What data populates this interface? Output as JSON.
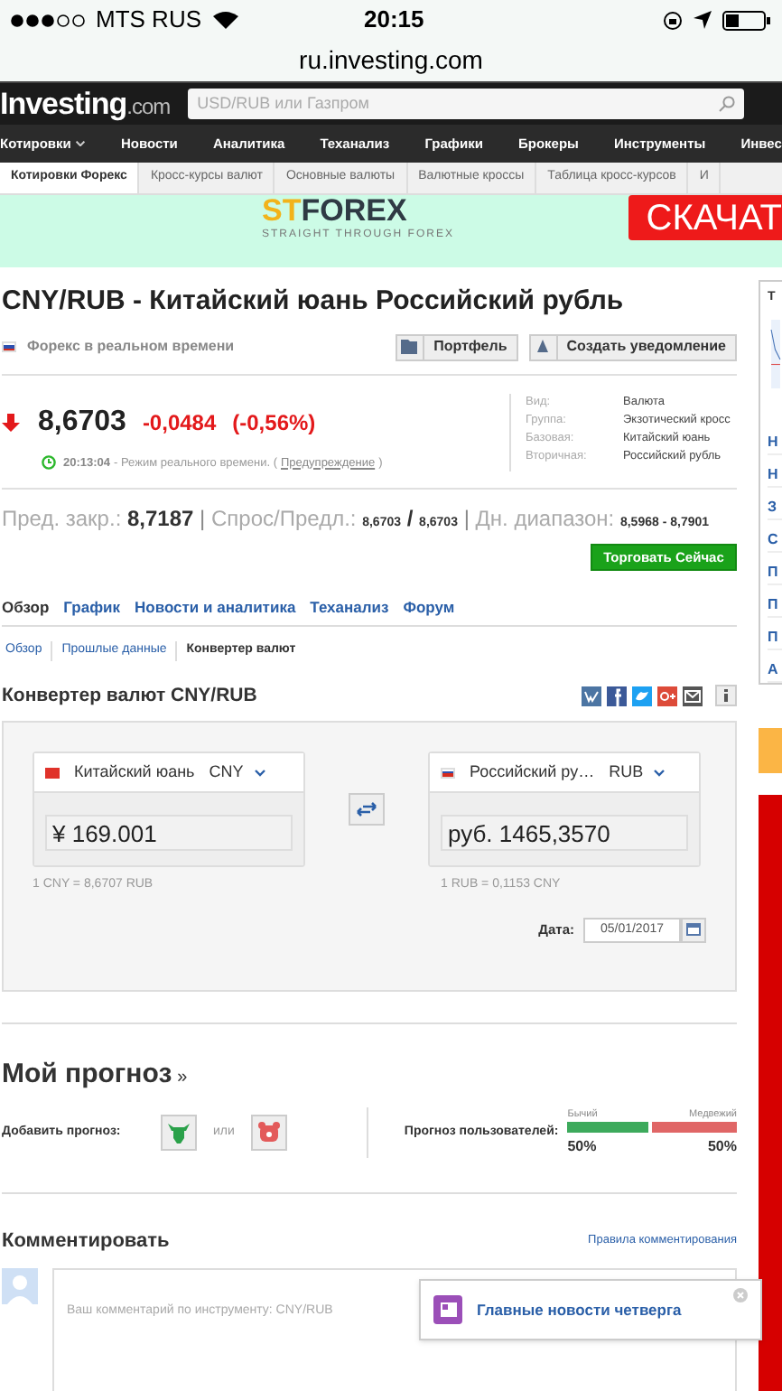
{
  "status_bar": {
    "carrier": "MTS RUS",
    "time": "20:15"
  },
  "url": "ru.investing.com",
  "header": {
    "logo": "Investing",
    "logo_suffix": ".com",
    "search_placeholder": "USD/RUB или Газпром"
  },
  "nav": [
    {
      "label": "Котировки",
      "has_menu": true
    },
    {
      "label": "Новости",
      "has_menu": false
    },
    {
      "label": "Аналитика",
      "has_menu": false
    },
    {
      "label": "Теханализ",
      "has_menu": false
    },
    {
      "label": "Графики",
      "has_menu": false
    },
    {
      "label": "Брокеры",
      "has_menu": false
    },
    {
      "label": "Инструменты",
      "has_menu": false
    },
    {
      "label": "Инвес",
      "has_menu": false
    }
  ],
  "subnav": [
    {
      "label": "Котировки Форекс",
      "selected": true
    },
    {
      "label": "Кросс-курсы валют",
      "selected": false
    },
    {
      "label": "Основные валюты",
      "selected": false
    },
    {
      "label": "Валютные кроссы",
      "selected": false
    },
    {
      "label": "Таблица кросс-курсов",
      "selected": false
    },
    {
      "label": "И",
      "selected": false
    }
  ],
  "ad": {
    "brand_prefix": "ST",
    "brand": "FOREX",
    "tagline": "STRAIGHT THROUGH FOREX",
    "cta": "СКАЧАТ"
  },
  "instrument": {
    "title": "CNY/RUB - Китайский юань Российский рубль",
    "market": "Форекс в реальном времени",
    "buttons": [
      "Портфель",
      "Создать уведомление"
    ],
    "price": "8,6703",
    "change": "-0,0484",
    "change_pct": "(-0,56%)",
    "falling": true,
    "time": "20:13:04",
    "time_note": "- Режим реального времени. (",
    "warning_link": "Предупреждение",
    "time_end": ")",
    "info": [
      {
        "label": "Вид:",
        "value": "Валюта"
      },
      {
        "label": "Группа:",
        "value": "Экзотический кросс"
      },
      {
        "label": "Базовая:",
        "value": "Китайский юань"
      },
      {
        "label": "Вторичная:",
        "value": "Российский рубль"
      }
    ],
    "prev_close_label": "Пред. закр.:",
    "prev_close": "8,7187",
    "separator": "|",
    "bid_ask_label": "Спрос/Предл.:",
    "bid": "8,6703",
    "bid_ask_sep": "/",
    "ask": "8,6703",
    "range_label": "Дн. диапазон:",
    "range": "8,5968 - 8,7901",
    "trade_button": "Торговать Сейчас"
  },
  "tabs": [
    {
      "label": "Обзор",
      "selected": true
    },
    {
      "label": "График",
      "selected": false
    },
    {
      "label": "Новости и аналитика",
      "selected": false
    },
    {
      "label": "Теханализ",
      "selected": false
    },
    {
      "label": "Форум",
      "selected": false
    }
  ],
  "subtabs": [
    {
      "label": "Обзор",
      "selected": false
    },
    {
      "label": "Прошлые данные",
      "selected": false
    },
    {
      "label": "Конвертер валют",
      "selected": true
    }
  ],
  "converter": {
    "title": "Конвертер валют CNY/RUB",
    "from": {
      "name": "Китайский юань",
      "code": "CNY",
      "amount": "¥ 169.001",
      "rate": "1 CNY = 8,6707 RUB"
    },
    "to": {
      "name": "Российский ру…",
      "code": "RUB",
      "amount": "руб. 1465,3570",
      "rate": "1 RUB = 0,1153 CNY"
    },
    "date_label": "Дата:",
    "date": "05/01/2017"
  },
  "forecast": {
    "title": "Мой прогноз",
    "title_mark": "»",
    "add_label": "Добавить прогноз:",
    "or": "или",
    "users_label": "Прогноз пользователей:",
    "bull_label": "Бычий",
    "bear_label": "Медвежий",
    "level": 0.5,
    "bull_pct": "50%",
    "bear_pct": "50%"
  },
  "comments": {
    "title": "Комментировать",
    "rules_link": "Правила комментирования",
    "placeholder": "Ваш комментарий по инструменту: CNY/RUB"
  },
  "popup": {
    "text": "Главные новости четверга"
  },
  "sidebar": {
    "tab": "Т",
    "links": [
      "Н",
      "Н",
      "З",
      "С",
      "П",
      "П",
      "П",
      "А"
    ]
  }
}
